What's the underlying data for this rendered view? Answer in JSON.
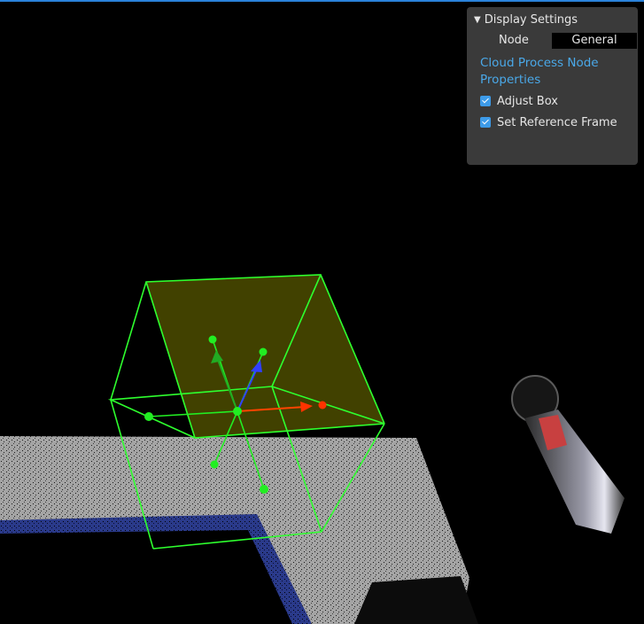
{
  "display_settings": {
    "title": "Display Settings",
    "node_label": "Node",
    "node_value": "General",
    "section_title": "Cloud Process Node Properties",
    "options": [
      {
        "label": "Adjust Box",
        "checked": true
      },
      {
        "label": "Set Reference Frame",
        "checked": true
      }
    ]
  },
  "colors": {
    "accent": "#2a82da",
    "panel_bg": "#3a3a3a",
    "link": "#4aa8e8",
    "box_edge": "#2eff2e",
    "box_face": "#5a5a00",
    "axis_x": "#ff3300",
    "axis_y": "#22aa22",
    "axis_z": "#3040ff"
  },
  "icons": {
    "collapse": "triangle-down-icon",
    "check": "checkmark-icon"
  }
}
